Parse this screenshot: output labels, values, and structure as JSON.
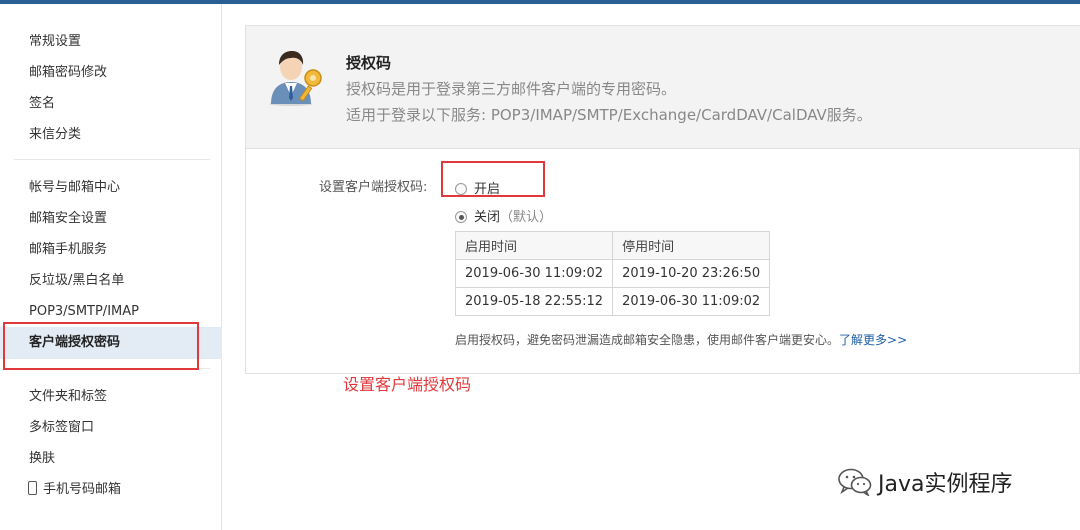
{
  "sidebar": {
    "items": [
      {
        "label": "常规设置"
      },
      {
        "label": "邮箱密码修改"
      },
      {
        "label": "签名"
      },
      {
        "label": "来信分类"
      },
      {
        "label": "帐号与邮箱中心"
      },
      {
        "label": "邮箱安全设置"
      },
      {
        "label": "邮箱手机服务"
      },
      {
        "label": "反垃圾/黑白名单"
      },
      {
        "label": "POP3/SMTP/IMAP"
      },
      {
        "label": "客户端授权密码"
      },
      {
        "label": "文件夹和标签"
      },
      {
        "label": "多标签窗口"
      },
      {
        "label": "换肤"
      },
      {
        "label": "手机号码邮箱"
      }
    ],
    "active_label": "客户端授权密码"
  },
  "header": {
    "title": "授权码",
    "desc1": "授权码是用于登录第三方邮件客户端的专用密码。",
    "desc2": "适用于登录以下服务: POP3/IMAP/SMTP/Exchange/CardDAV/CalDAV服务。",
    "avatar_icon": "user-key-icon"
  },
  "settings": {
    "label": "设置客户端授权码:",
    "options": [
      {
        "label": "开启",
        "checked": false
      },
      {
        "label": "关闭",
        "suffix": "（默认）",
        "checked": true
      }
    ]
  },
  "log_table": {
    "headers": [
      "启用时间",
      "停用时间"
    ],
    "rows": [
      [
        "2019-06-30 11:09:02",
        "2019-10-20 23:26:50"
      ],
      [
        "2019-05-18 22:55:12",
        "2019-06-30 11:09:02"
      ]
    ]
  },
  "tip": {
    "text": "启用授权码，避免密码泄漏造成邮箱安全隐患，使用邮件客户端更安心。",
    "link": "了解更多>>"
  },
  "annotation": {
    "caption": "设置客户端授权码",
    "color": "#e0393c"
  },
  "watermark": {
    "text": "Java实例程序",
    "icon": "wechat-icon"
  },
  "colors": {
    "topbar": "#2b5f94",
    "active_bg": "#e3ebf4",
    "link": "#1f5fa6"
  }
}
